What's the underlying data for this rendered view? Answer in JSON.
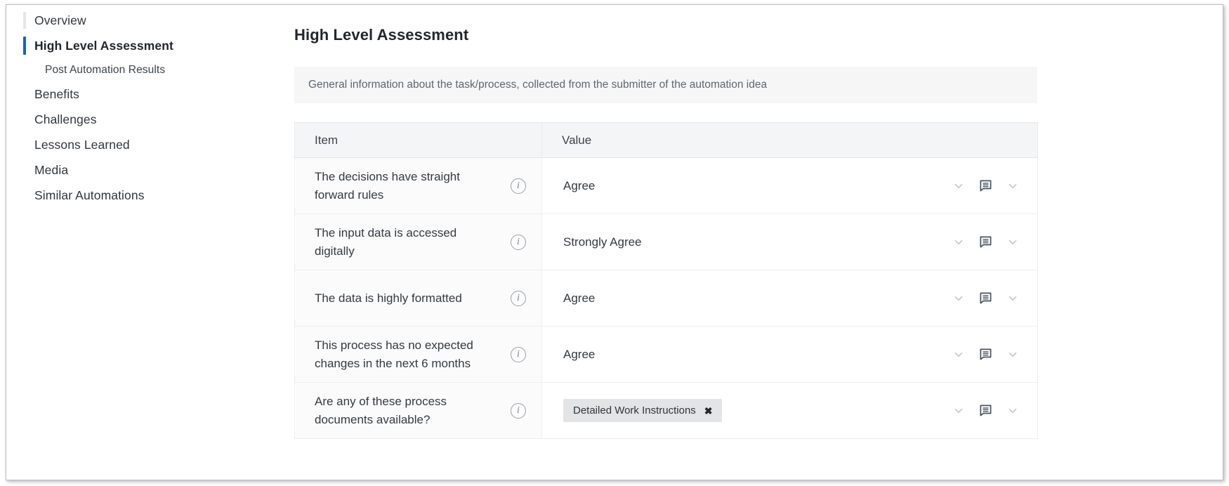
{
  "sidebar": {
    "items": [
      {
        "label": "Overview",
        "level": "top",
        "active": false,
        "rail": true
      },
      {
        "label": "High Level Assessment",
        "level": "top",
        "active": true,
        "rail": true
      },
      {
        "label": "Post Automation Results",
        "level": "sub",
        "active": false,
        "rail": false
      },
      {
        "label": "Benefits",
        "level": "top",
        "active": false,
        "rail": false
      },
      {
        "label": "Challenges",
        "level": "top",
        "active": false,
        "rail": false
      },
      {
        "label": "Lessons Learned",
        "level": "top",
        "active": false,
        "rail": false
      },
      {
        "label": "Media",
        "level": "top",
        "active": false,
        "rail": false
      },
      {
        "label": "Similar Automations",
        "level": "top",
        "active": false,
        "rail": false
      }
    ]
  },
  "main": {
    "title": "High Level Assessment",
    "banner": "General information about the task/process, collected from the submitter of the automation idea",
    "table": {
      "columns": [
        "Item",
        "Value"
      ],
      "rows": [
        {
          "item": "The decisions have straight forward rules",
          "value": "Agree",
          "value_type": "text",
          "info_icon": "info-circle-icon",
          "actions": [
            "chevron-down-icon",
            "comment-icon",
            "chevron-down-icon"
          ]
        },
        {
          "item": "The input data is accessed digitally",
          "value": "Strongly Agree",
          "value_type": "text",
          "info_icon": "info-circle-icon",
          "actions": [
            "chevron-down-icon",
            "comment-icon",
            "chevron-down-icon"
          ]
        },
        {
          "item": "The data is highly formatted",
          "value": "Agree",
          "value_type": "text",
          "info_icon": "info-circle-icon",
          "actions": [
            "chevron-down-icon",
            "comment-icon",
            "chevron-down-icon"
          ]
        },
        {
          "item": "This process has no expected changes in the next 6 months",
          "value": "Agree",
          "value_type": "text",
          "info_icon": "info-circle-icon",
          "actions": [
            "chevron-down-icon",
            "comment-icon",
            "chevron-down-icon"
          ]
        },
        {
          "item": "Are any of these process documents available?",
          "value": "Detailed Work Instructions",
          "value_type": "tag",
          "tag_remove": "✖",
          "info_icon": "info-circle-icon",
          "actions": [
            "chevron-down-icon",
            "comment-icon",
            "chevron-down-icon"
          ]
        }
      ]
    }
  },
  "icons": {
    "info_glyph": "i"
  },
  "colors": {
    "accent_active": "#0d62d9",
    "rail_inactive": "#e4e7ea",
    "header_bg": "#f4f5f6",
    "banner_bg": "#f6f6f7",
    "item_cell_bg": "#fbfbfc",
    "tag_bg": "#e3e4e6",
    "comment_icon": "#4b555f",
    "chevron": "#c8ccd0",
    "text": "#343a40"
  }
}
